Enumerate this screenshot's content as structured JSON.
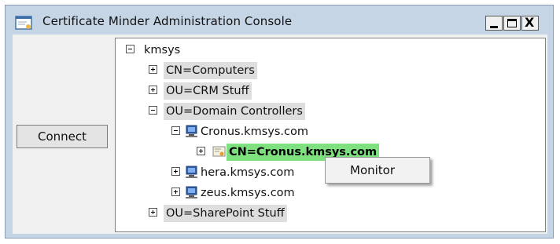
{
  "window": {
    "title": "Certificate Minder Administration Console",
    "controls": {
      "minimize": "_",
      "maximize": "□",
      "close": "X"
    }
  },
  "connect_label": "Connect",
  "tree": {
    "root": "kmsys",
    "computers": "CN=Computers",
    "crm": "OU=CRM Stuff",
    "domain_controllers": "OU=Domain Controllers",
    "cronus": "Cronus.kmsys.com",
    "cert": "CN=Cronus.kmsys.com",
    "hera": "hera.kmsys.com",
    "zeus": "zeus.kmsys.com",
    "sharepoint": "OU=SharePoint Stuff"
  },
  "context_menu": {
    "monitor": "Monitor"
  },
  "colors": {
    "frame": "#c6d5e6",
    "selected": "#7ee07e",
    "ou_highlight": "#dedede"
  }
}
